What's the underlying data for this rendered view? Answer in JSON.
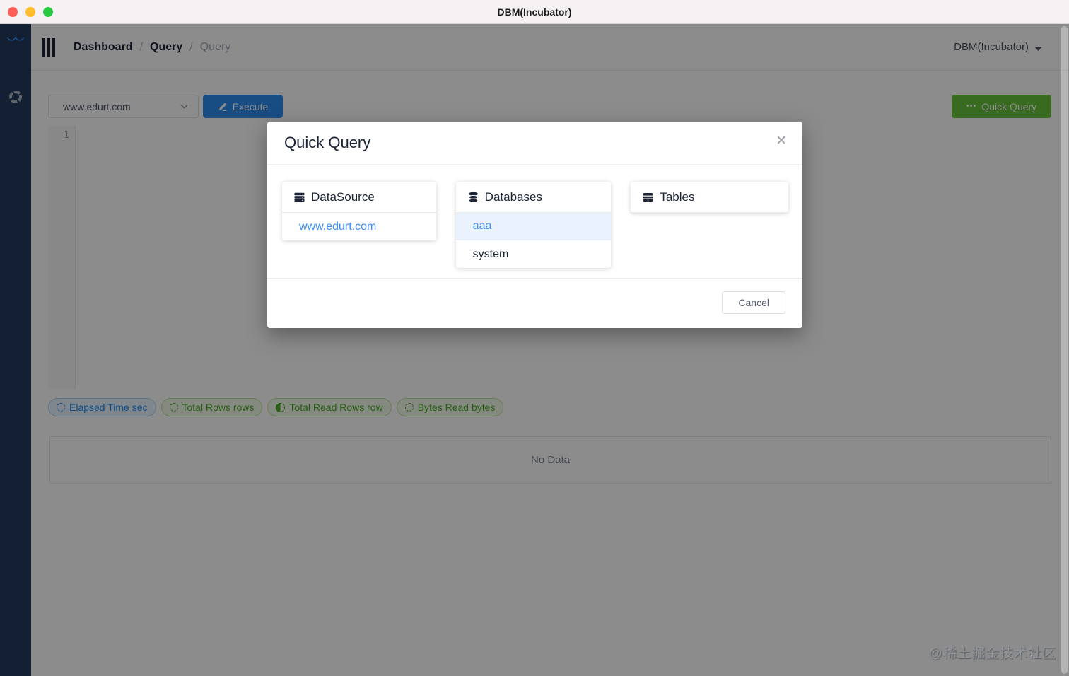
{
  "window": {
    "title": "DBM(Incubator)"
  },
  "header": {
    "breadcrumb": [
      "Dashboard",
      "Query",
      "Query"
    ],
    "separator": "/",
    "account_label": "DBM(Incubator)"
  },
  "toolbar": {
    "datasource_value": "www.edurt.com",
    "execute_label": "Execute",
    "quick_query_label": "Quick Query",
    "quick_query_icon": "•••"
  },
  "editor": {
    "line_number": "1"
  },
  "metrics": [
    {
      "label": "Elapsed Time sec",
      "color": "#1890ff",
      "icon": "dashed-circle"
    },
    {
      "label": "Total Rows rows",
      "color": "#52c41a",
      "icon": "dashed-circle"
    },
    {
      "label": "Total Read Rows row",
      "color": "#52c41a",
      "icon": "half-circle"
    },
    {
      "label": "Bytes Read bytes",
      "color": "#52c41a",
      "icon": "dashed-circle"
    }
  ],
  "results": {
    "empty_text": "No Data"
  },
  "modal": {
    "title": "Quick Query",
    "close_icon": "✕",
    "cancel_label": "Cancel",
    "panels": [
      {
        "title": "DataSource",
        "items": [
          {
            "label": "www.edurt.com",
            "state": "link"
          }
        ]
      },
      {
        "title": "Databases",
        "items": [
          {
            "label": "aaa",
            "state": "selected"
          },
          {
            "label": "system",
            "state": "normal"
          }
        ]
      },
      {
        "title": "Tables",
        "items": []
      }
    ]
  },
  "watermark": "@稀土掘金技术社区",
  "colors": {
    "primary": "#2d8cf0",
    "success": "#67c23a",
    "sidebar": "#243a5e",
    "link": "#3d8df5",
    "selected_row_bg": "#e9f2fd"
  }
}
